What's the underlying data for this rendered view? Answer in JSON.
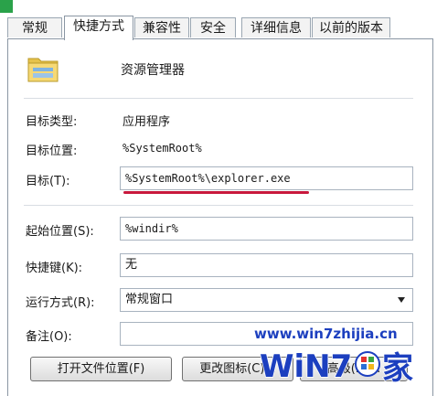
{
  "tabs": [
    {
      "label": "常规",
      "active": false
    },
    {
      "label": "快捷方式",
      "active": true
    },
    {
      "label": "兼容性",
      "active": false
    },
    {
      "label": "安全",
      "active": false
    },
    {
      "label": "详细信息",
      "active": false
    },
    {
      "label": "以前的版本",
      "active": false
    }
  ],
  "shortcut": {
    "icon": "folder-icon",
    "name": "资源管理器"
  },
  "fields": {
    "target_type_label": "目标类型:",
    "target_type_value": "应用程序",
    "target_location_label": "目标位置:",
    "target_location_value": "%SystemRoot%",
    "target_label": "目标(T):",
    "target_value": "%SystemRoot%\\explorer.exe",
    "start_in_label": "起始位置(S):",
    "start_in_value": "%windir%",
    "shortcut_key_label": "快捷键(K):",
    "shortcut_key_value": "无",
    "run_label": "运行方式(R):",
    "run_value": "常规窗口",
    "comment_label": "备注(O):",
    "comment_value": ""
  },
  "buttons": {
    "open_location": "打开文件位置(F)",
    "change_icon": "更改图标(C)...",
    "advanced": "高级(D)..."
  },
  "watermark": {
    "url": "www.win7zhijia.cn",
    "logo_text": "WiN7",
    "logo_char": "家"
  },
  "colors": {
    "accent_underline": "#c8183c",
    "watermark_blue": "#1c3fbf"
  }
}
